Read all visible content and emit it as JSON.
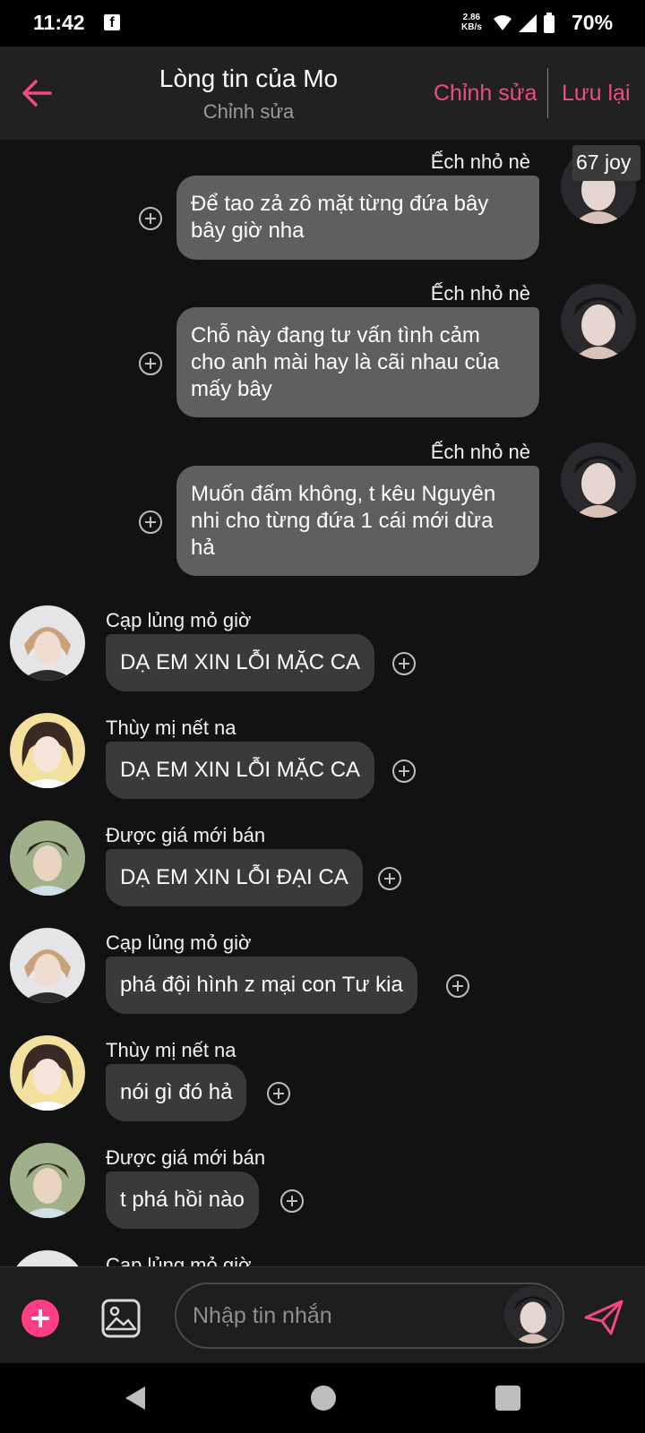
{
  "status_bar": {
    "time": "11:42",
    "net_speed_value": "2.86",
    "net_speed_unit": "KB/s",
    "battery": "70%",
    "app_icon": "facebook-icon"
  },
  "header": {
    "title": "Lòng tin của Mo",
    "subtitle": "Chỉnh sửa",
    "edit_label": "Chỉnh sửa",
    "save_label": "Lưu lại",
    "accent_color": "#ef4a86"
  },
  "overlay": {
    "joy_badge": "67 joy"
  },
  "messages": [
    {
      "side": "right",
      "sender": "Ếch nhỏ nè",
      "lines": [
        "Để tao zả zô mặt từng đứa bây",
        "bây giờ nha"
      ]
    },
    {
      "side": "right",
      "sender": "Ếch nhỏ nè",
      "lines": [
        "Chỗ này đang tư vấn tình cảm",
        "cho anh mài hay là cãi nhau của",
        "mấy bây"
      ]
    },
    {
      "side": "right",
      "sender": "Ếch nhỏ nè",
      "lines": [
        "Muốn đấm không, t kêu Nguyên",
        "nhi cho từng đứa 1 cái mới dừa",
        "hả"
      ]
    },
    {
      "side": "left",
      "sender": "Cạp lủng mỏ giờ",
      "text": "DẠ EM XIN LỖI MẶC CA"
    },
    {
      "side": "left",
      "sender": "Thùy mị nết na",
      "text": "DẠ EM XIN LỖI MẶC CA"
    },
    {
      "side": "left",
      "sender": "Được giá mới bán",
      "text": "DẠ EM XIN LỖI ĐẠI CA"
    },
    {
      "side": "left",
      "sender": "Cạp lủng mỏ giờ",
      "text": "phá đội hình z mại con Tư kia"
    },
    {
      "side": "left",
      "sender": "Thùy mị nết na",
      "text": "nói gì đó hả"
    },
    {
      "side": "left",
      "sender": "Được giá mới bán",
      "text": "t phá hồi nào"
    },
    {
      "side": "left",
      "sender": "Cạp lủng mỏ giờ",
      "text": ""
    }
  ],
  "composer": {
    "placeholder": "Nhập tin nhắn",
    "add_icon": "plus-circle-icon",
    "image_icon": "image-icon",
    "send_icon": "send-icon",
    "add_color": "#ff3e86"
  },
  "nav": {
    "back_icon": "triangle-back-icon",
    "home_icon": "circle-home-icon",
    "recents_icon": "square-recents-icon"
  }
}
